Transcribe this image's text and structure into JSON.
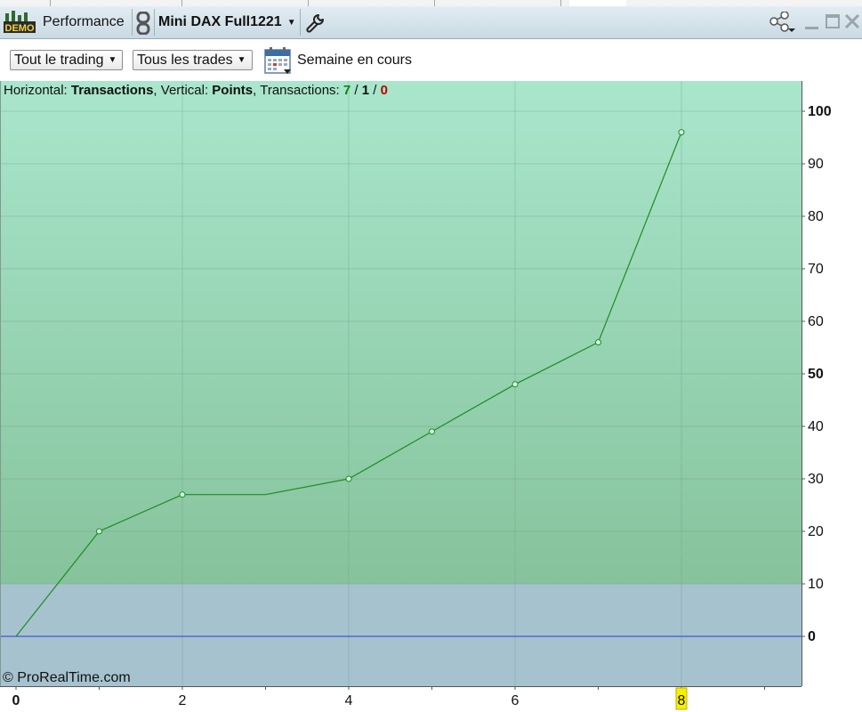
{
  "window": {
    "demo_badge": "DEMO",
    "title": "Performance",
    "instrument": "Mini DAX Full1221"
  },
  "toolbar": {
    "filter_trading": "Tout le trading",
    "filter_trades": "Tous les trades",
    "period": "Semaine en cours"
  },
  "info": {
    "horizontal_label": "Horizontal:",
    "horizontal_value": "Transactions",
    "vertical_label": "Vertical:",
    "vertical_value": "Points",
    "transactions_label": "Transactions:",
    "count_win": "7",
    "count_neutral": "1",
    "count_loss": "0"
  },
  "copyright": "© ProRealTime.com",
  "colors": {
    "accent_line": "#1e8c1e",
    "zero_line": "#2a3ccc",
    "positive_bg_top": "#a9e6cc",
    "positive_bg_bottom": "#86c39c",
    "negative_bg": "#a6c2cf"
  },
  "chart_data": {
    "type": "line",
    "x": [
      0,
      1,
      2,
      3,
      4,
      5,
      6,
      7,
      8
    ],
    "y": [
      0,
      20,
      27,
      27,
      30,
      39,
      48,
      56,
      96
    ],
    "markers_at": [
      1,
      2,
      4,
      5,
      6,
      7,
      8
    ],
    "xlim": [
      0,
      9.5
    ],
    "ylim": [
      -10,
      105
    ],
    "x_ticks": [
      "0",
      "2",
      "4",
      "6",
      "8"
    ],
    "x_ticks_bold": [
      "0"
    ],
    "x_tick_highlight": "8",
    "y_ticks": [
      "0",
      "10",
      "20",
      "30",
      "40",
      "50",
      "60",
      "70",
      "80",
      "90",
      "100"
    ],
    "y_ticks_bold": [
      "0",
      "50",
      "100"
    ],
    "grid": true
  }
}
